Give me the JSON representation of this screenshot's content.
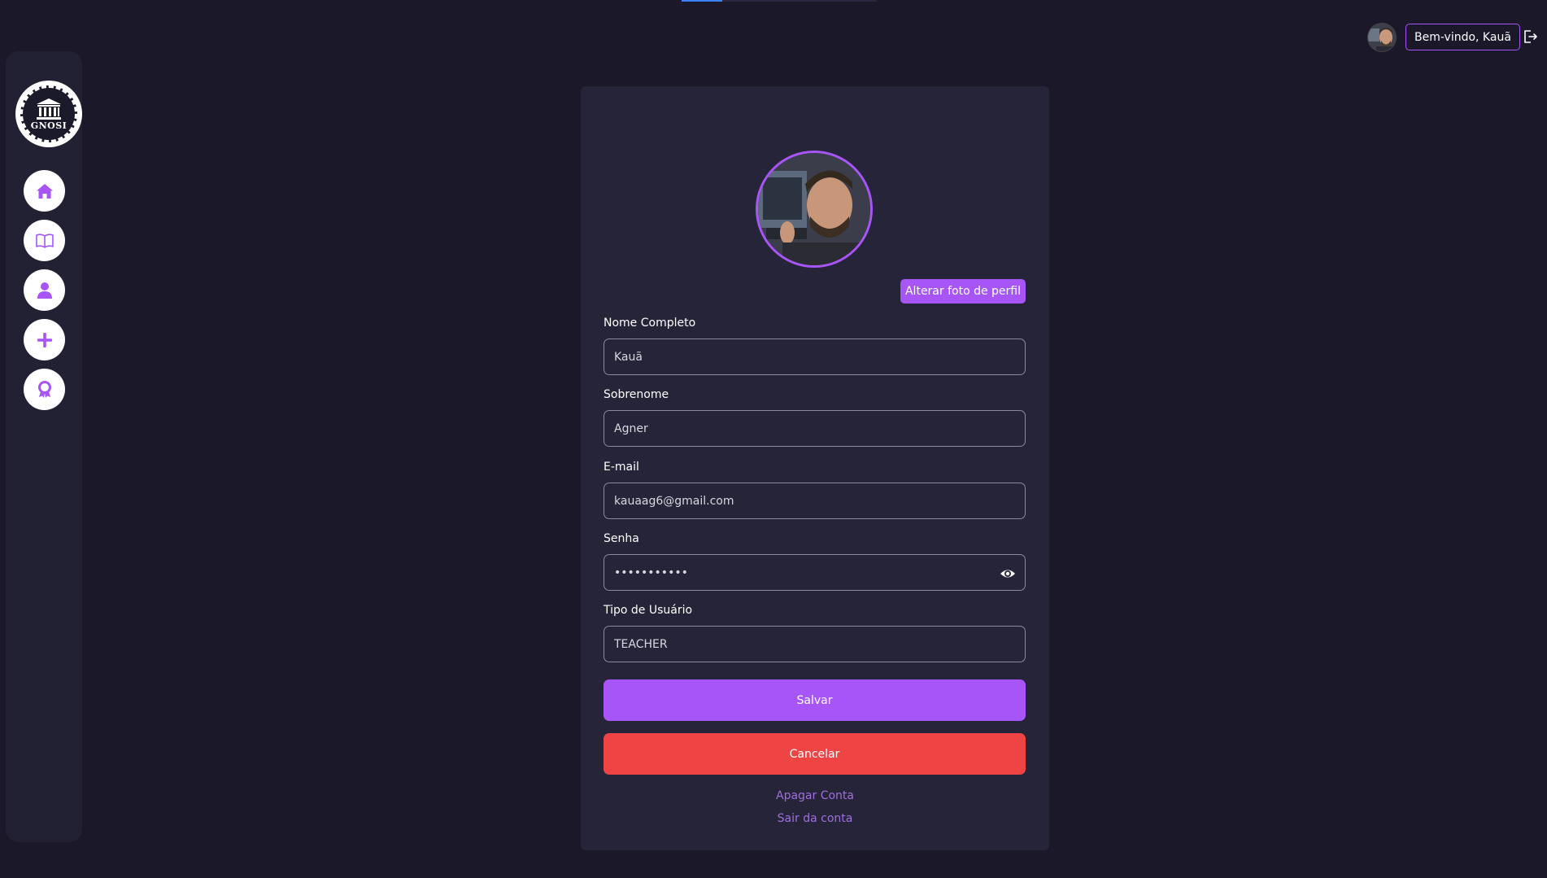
{
  "header": {
    "welcome_text": "Bem-vindo, Kauã"
  },
  "sidebar": {
    "logo_text": "GNOSI",
    "items": [
      {
        "name": "home",
        "icon": "home-icon"
      },
      {
        "name": "courses",
        "icon": "book-icon"
      },
      {
        "name": "profile",
        "icon": "user-icon"
      },
      {
        "name": "add",
        "icon": "plus-icon"
      },
      {
        "name": "certificates",
        "icon": "award-icon"
      }
    ]
  },
  "profile": {
    "change_photo_label": "Alterar foto de perfil",
    "fields": {
      "full_name": {
        "label": "Nome Completo",
        "value": "Kauã"
      },
      "last_name": {
        "label": "Sobrenome",
        "value": "Agner"
      },
      "email": {
        "label": "E-mail",
        "value": "kauaag6@gmail.com"
      },
      "password": {
        "label": "Senha",
        "value": "kauaagner12"
      },
      "user_type": {
        "label": "Tipo de Usuário",
        "value": "TEACHER"
      }
    },
    "save_label": "Salvar",
    "cancel_label": "Cancelar",
    "delete_account_label": "Apagar Conta",
    "logout_label": "Sair da conta"
  },
  "colors": {
    "background": "#1a1829",
    "sidebar": "#222033",
    "card": "#262438",
    "accent": "#a855f7",
    "danger": "#ef4444",
    "link": "#9f6fdc"
  }
}
